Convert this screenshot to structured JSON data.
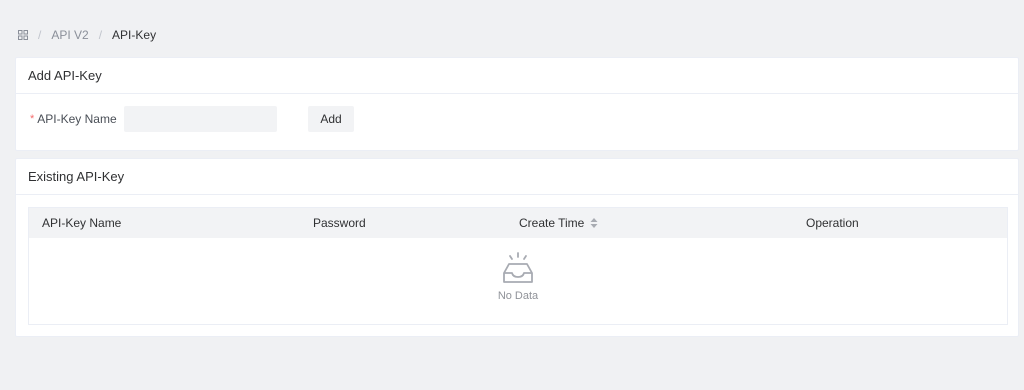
{
  "breadcrumb": {
    "home_icon": "grid-icon",
    "separator": "/",
    "items": [
      "API V2",
      "API-Key"
    ]
  },
  "add_card": {
    "title": "Add API-Key",
    "required_mark": "*",
    "name_label": "API-Key Name",
    "name_value": "",
    "name_placeholder": "",
    "add_button": "Add"
  },
  "existing_card": {
    "title": "Existing API-Key",
    "columns": [
      "API-Key Name",
      "Password",
      "Create Time",
      "Operation"
    ],
    "sort_icon": "sort-icon",
    "rows": [],
    "empty_icon": "empty-inbox-icon",
    "empty_text": "No Data"
  },
  "colors": {
    "required": "#f56c6c",
    "page_bg": "#f0f1f3",
    "header_bg": "#f2f3f5"
  }
}
